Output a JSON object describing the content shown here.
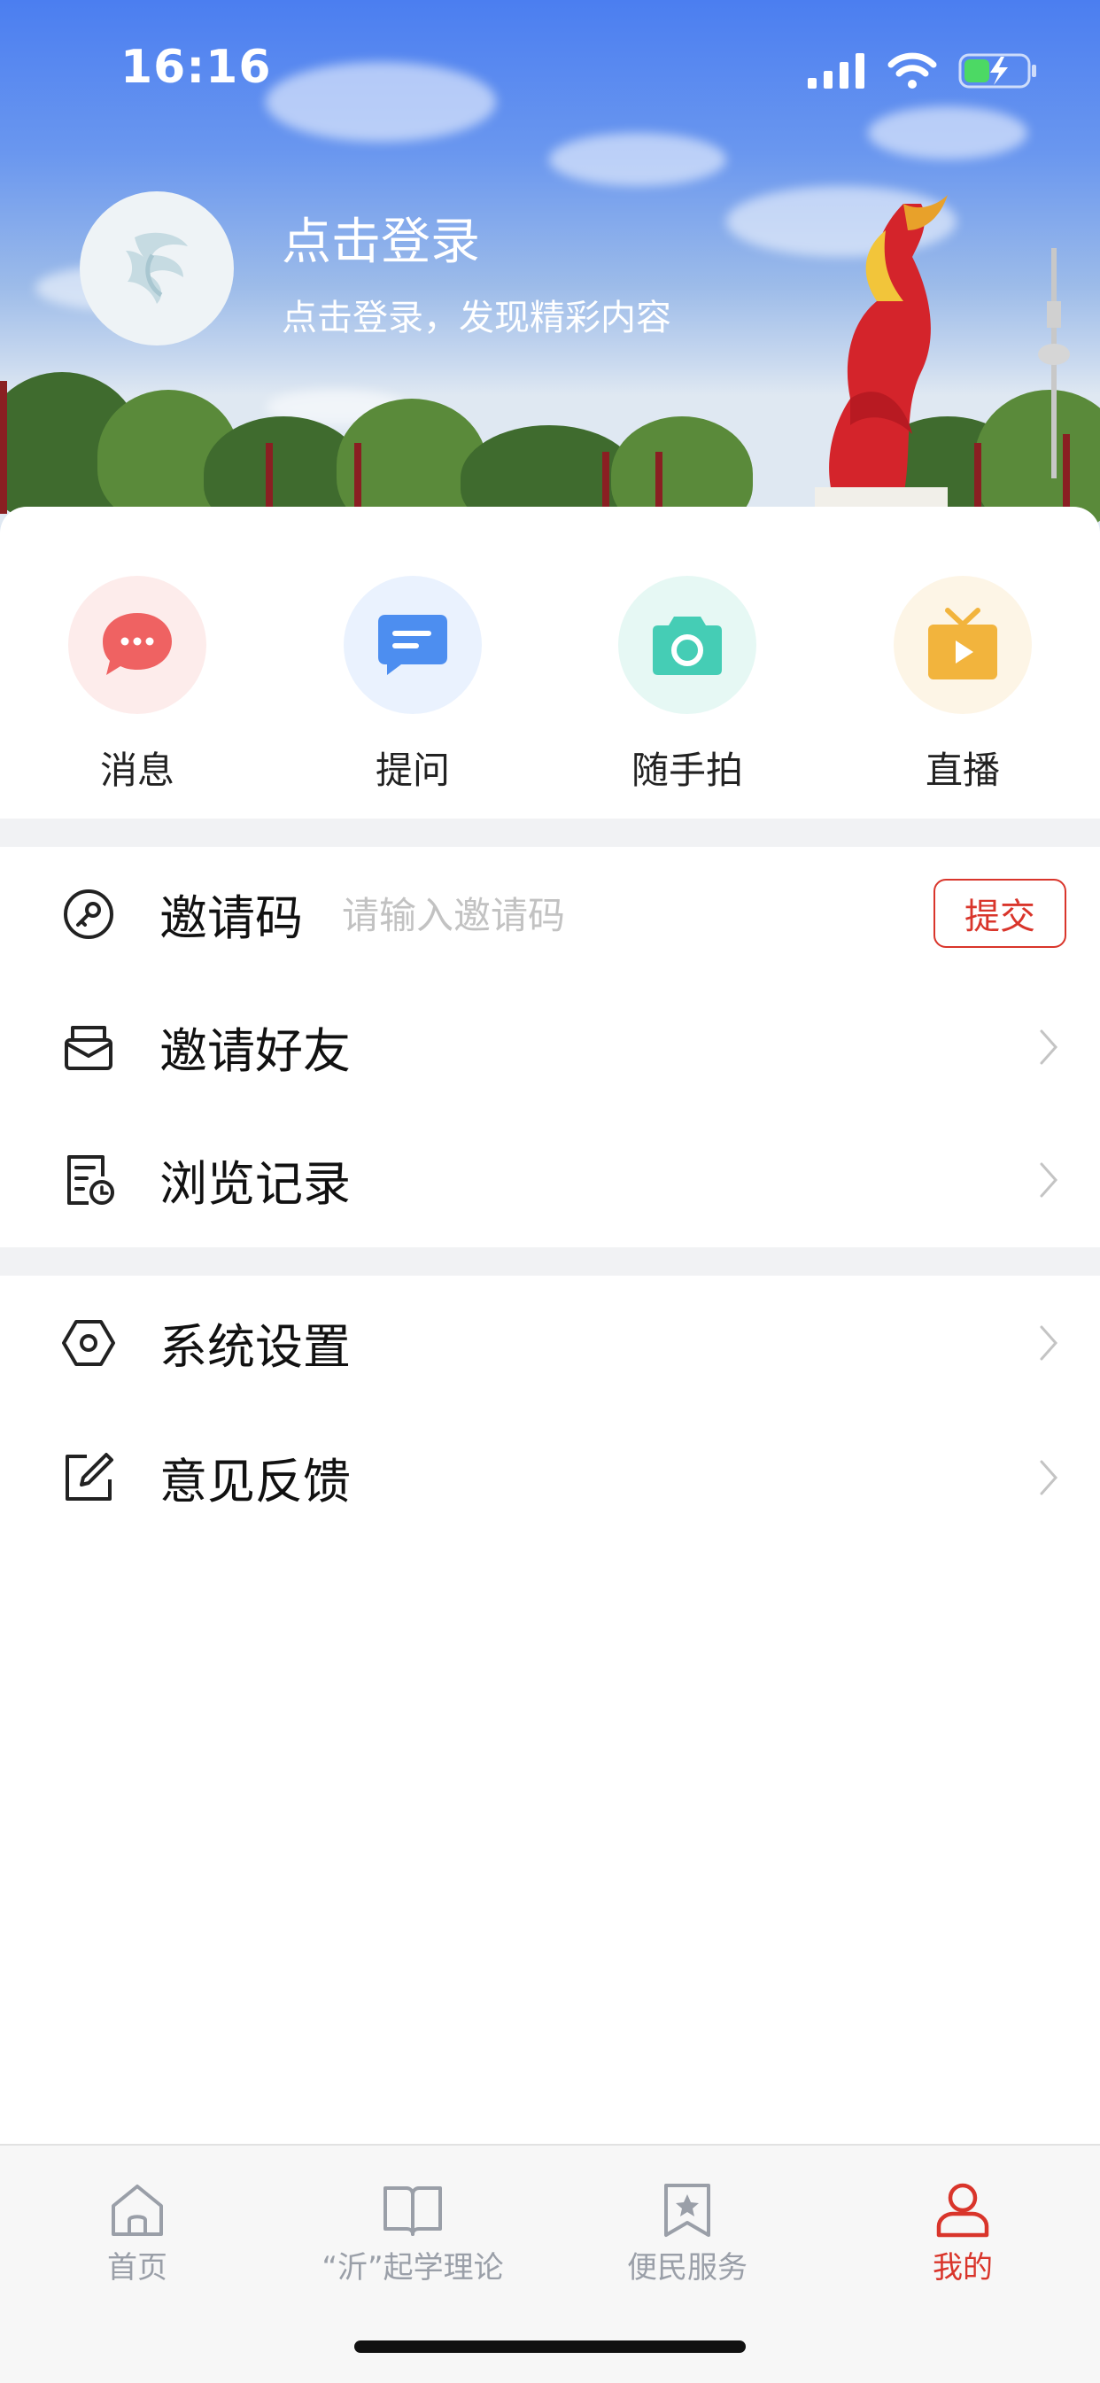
{
  "status_bar": {
    "time": "16:16"
  },
  "profile": {
    "title": "点击登录",
    "subtitle": "点击登录，发现精彩内容",
    "avatar_icon": "phoenix-logo-icon"
  },
  "quick_actions": [
    {
      "label": "消息",
      "icon": "chat-bubble-icon",
      "color": "#ef6262",
      "bg": "#fdeceb"
    },
    {
      "label": "提问",
      "icon": "question-message-icon",
      "color": "#4d8ef0",
      "bg": "#eaf2fe"
    },
    {
      "label": "随手拍",
      "icon": "camera-icon",
      "color": "#45cdb5",
      "bg": "#e6f8f4"
    },
    {
      "label": "直播",
      "icon": "tv-play-icon",
      "color": "#f2b43d",
      "bg": "#fdf5e6"
    }
  ],
  "invite_code": {
    "label": "邀请码",
    "placeholder": "请输入邀请码",
    "value": "",
    "submit_label": "提交",
    "icon": "key-icon"
  },
  "menu_group_1": [
    {
      "label": "邀请好友",
      "icon": "mail-inbox-icon"
    },
    {
      "label": "浏览记录",
      "icon": "history-doc-icon"
    }
  ],
  "menu_group_2": [
    {
      "label": "系统设置",
      "icon": "settings-hex-icon"
    },
    {
      "label": "意见反馈",
      "icon": "edit-feedback-icon"
    }
  ],
  "tab_bar": {
    "active_index": 3,
    "accent_color": "#d9352b",
    "items": [
      {
        "label": "首页",
        "icon": "home-icon"
      },
      {
        "label": "“沂”起学理论",
        "icon": "book-icon"
      },
      {
        "label": "便民服务",
        "icon": "star-bookmark-icon"
      },
      {
        "label": "我的",
        "icon": "user-icon"
      }
    ]
  }
}
